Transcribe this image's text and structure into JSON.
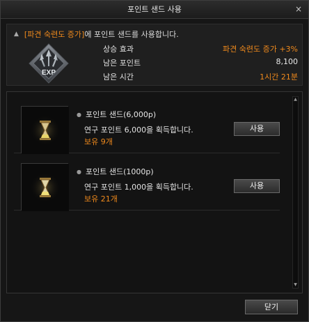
{
  "window": {
    "title": "포인트 샌드 사용",
    "close_glyph": "×"
  },
  "info": {
    "header_accent": "[파견 숙련도 증가]",
    "header_rest": "에 포인트 샌드를 사용합니다.",
    "emblem_label": "EXP",
    "stats": [
      {
        "key": "상승 효과",
        "value": "파견 숙련도 증가 +3%"
      },
      {
        "key": "남은 포인트",
        "value": "8,100"
      },
      {
        "key": "남은 시간",
        "value": "1시간 21분"
      }
    ]
  },
  "items": [
    {
      "name": "포인트 샌드(6,000p)",
      "desc": "연구 포인트 6,000을 획득합니다.",
      "count": "보유 9개",
      "button": "사용"
    },
    {
      "name": "포인트 샌드(1000p)",
      "desc": "연구 포인트 1,000을 획득합니다.",
      "count": "보유 21개",
      "button": "사용"
    }
  ],
  "footer": {
    "close_label": "닫기"
  },
  "colors": {
    "accent": "#f08a1c",
    "background": "#161616"
  }
}
